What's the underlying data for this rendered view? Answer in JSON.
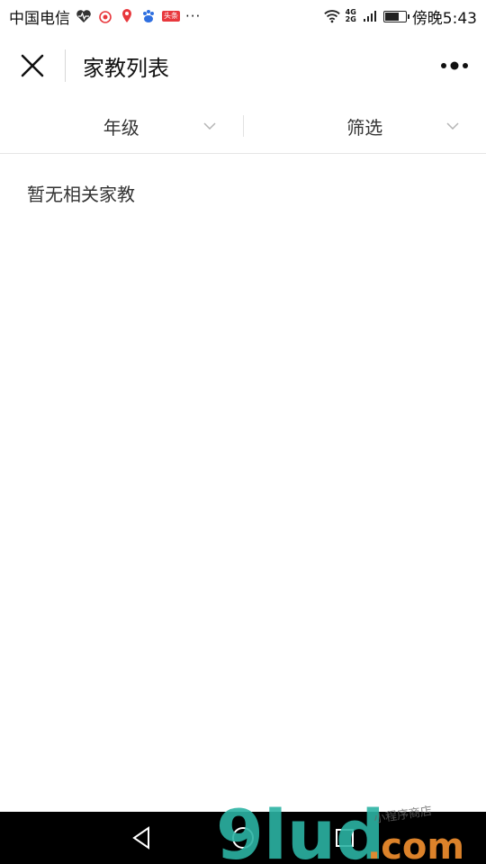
{
  "status_bar": {
    "carrier": "中国电信",
    "notification_icons": [
      "heart-rate-icon",
      "weibo-icon",
      "map-pin-icon",
      "baidu-icon",
      "toutiao-icon"
    ],
    "toutiao_badge": "头条",
    "more": "···",
    "network_top": "4G",
    "network_bottom": "2G",
    "time": "傍晚5:43",
    "battery_level": 0.7
  },
  "header": {
    "title": "家教列表",
    "close_icon": "close-icon",
    "more_icon": "more-dots-icon"
  },
  "filters": {
    "grade_label": "年级",
    "filter_label": "筛选"
  },
  "content": {
    "empty_message": "暂无相关家教"
  },
  "nav_bar": {
    "buttons": [
      "back-icon",
      "home-icon",
      "recents-icon"
    ]
  },
  "watermark": {
    "brand": "9lud",
    "suffix": ".com",
    "tagline": "小程序商店"
  },
  "colors": {
    "background": "#ffffff",
    "text": "#333333",
    "divider": "#e6e6e6",
    "nav_bar": "#000000",
    "watermark_teal": "#2bb3a3",
    "watermark_orange": "#e8892c"
  }
}
